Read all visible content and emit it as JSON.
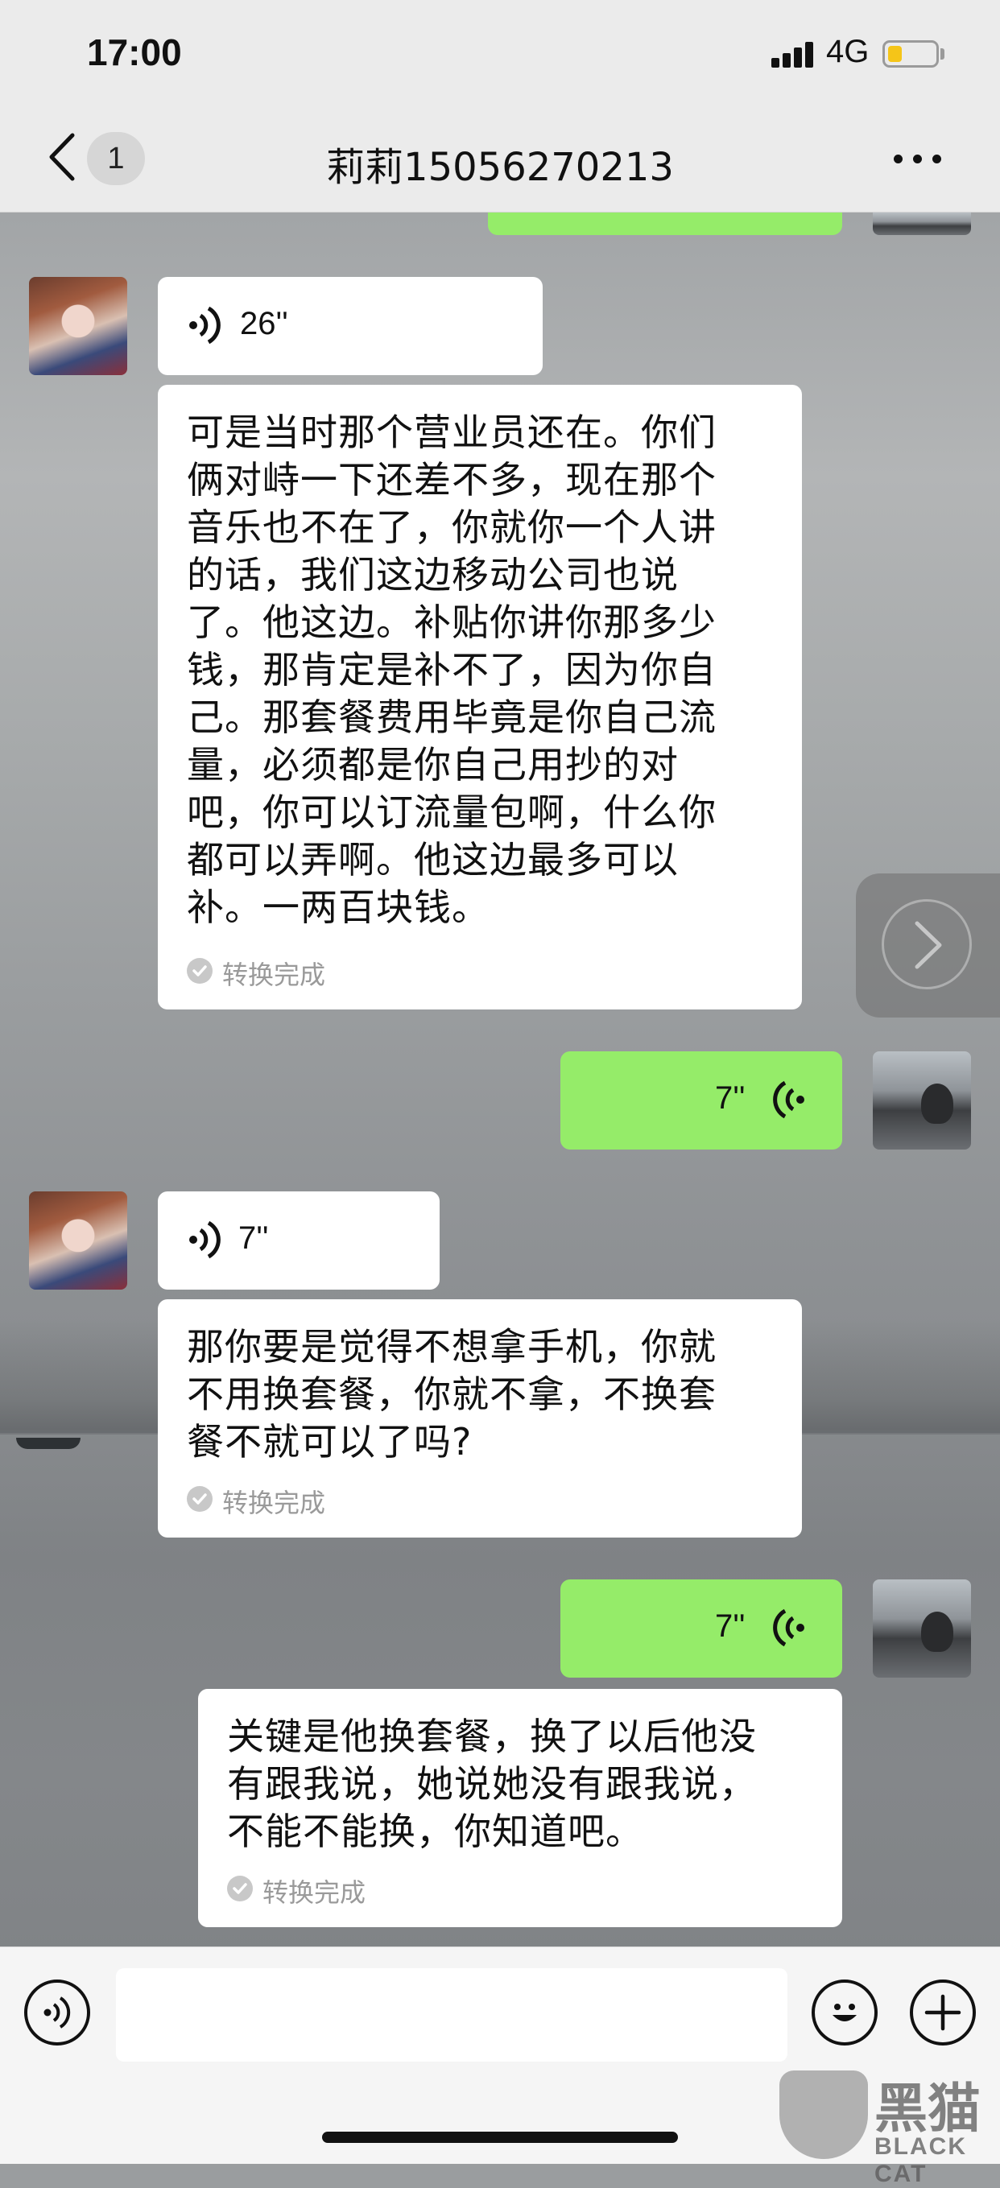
{
  "status_bar": {
    "time": "17:00",
    "network": "4G",
    "battery_level": 0.3
  },
  "header": {
    "unread_count": "1",
    "title": "莉莉15056270213"
  },
  "messages": [
    {
      "side": "left",
      "type": "voice",
      "duration": "26''"
    },
    {
      "side": "left",
      "type": "transcript",
      "lines": [
        "可是当时那个营业员还在。你们",
        "俩对峙一下还差不多，现在那个",
        "音乐也不在了，你就你一个人讲",
        "的话，我们这边移动公司也说",
        "了。他这边。补贴你讲你那多少",
        "钱，那肯定是补不了，因为你自",
        "己。那套餐费用毕竟是你自己流",
        "量，必须都是你自己用抄的对",
        "吧，你可以订流量包啊，什么你",
        "都可以弄啊。他这边最多可以",
        "补。一两百块钱。"
      ],
      "status": "转换完成"
    },
    {
      "side": "right",
      "type": "voice",
      "duration": "7''"
    },
    {
      "side": "left",
      "type": "voice",
      "duration": "7''"
    },
    {
      "side": "left",
      "type": "transcript",
      "lines": [
        "那你要是觉得不想拿手机，你就",
        "不用换套餐，你就不拿，不换套",
        "餐不就可以了吗?"
      ],
      "status": "转换完成"
    },
    {
      "side": "right",
      "type": "voice",
      "duration": "7''"
    },
    {
      "side": "right",
      "type": "transcript",
      "lines": [
        "关键是他换套餐，换了以后他没",
        "有跟我说，她说她没有跟我说，",
        "不能不能换，你知道吧。"
      ],
      "status": "转换完成"
    }
  ],
  "input": {
    "placeholder": ""
  },
  "watermark": {
    "title": "黑猫",
    "subtitle": "BLACK CAT"
  },
  "colors": {
    "bubble_green": "#95ec69",
    "bubble_white": "#ffffff",
    "bar_gray": "#ebebeb"
  }
}
